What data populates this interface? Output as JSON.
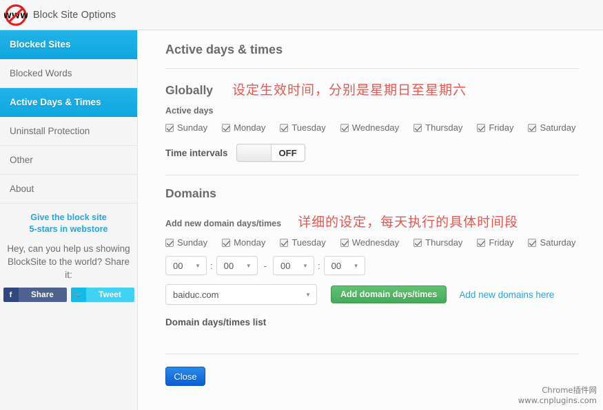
{
  "window": {
    "title": "Block Site Options",
    "logo_icon": "www-blocked-icon"
  },
  "sidebar": {
    "items": [
      {
        "label": "Blocked Sites",
        "active": true
      },
      {
        "label": "Blocked Words",
        "active": false
      },
      {
        "label": "Active Days & Times",
        "active": true
      },
      {
        "label": "Uninstall Protection",
        "active": false
      },
      {
        "label": "Other",
        "active": false
      },
      {
        "label": "About",
        "active": false
      }
    ],
    "rate_line1": "Give the block site",
    "rate_line2": "5-stars in webstore",
    "share_prompt": "Hey, can you help us showing BlockSite to the world? Share it:",
    "facebook": {
      "icon": "facebook-icon",
      "glyph": "f",
      "label": "Share"
    },
    "twitter": {
      "icon": "twitter-icon",
      "glyph": "🐦",
      "label": "Tweet"
    }
  },
  "main": {
    "page_title": "Active days & times",
    "globally": {
      "title": "Globally",
      "note_cn": "设定生效时间，分别是星期日至星期六",
      "active_days_label": "Active days",
      "days": [
        {
          "label": "Sunday",
          "checked": true
        },
        {
          "label": "Monday",
          "checked": true
        },
        {
          "label": "Tuesday",
          "checked": true
        },
        {
          "label": "Wednesday",
          "checked": true
        },
        {
          "label": "Thursday",
          "checked": true
        },
        {
          "label": "Friday",
          "checked": true
        },
        {
          "label": "Saturday",
          "checked": true
        }
      ],
      "time_intervals_label": "Time intervals",
      "toggle_state": "OFF"
    },
    "domains": {
      "title": "Domains",
      "add_label": "Add new domain days/times",
      "note_cn": "详细的设定，每天执行的具体时间段",
      "days": [
        {
          "label": "Sunday",
          "checked": true
        },
        {
          "label": "Monday",
          "checked": true
        },
        {
          "label": "Tuesday",
          "checked": true
        },
        {
          "label": "Wednesday",
          "checked": true
        },
        {
          "label": "Thursday",
          "checked": true
        },
        {
          "label": "Friday",
          "checked": true
        },
        {
          "label": "Saturday",
          "checked": true
        }
      ],
      "time_from_hour": "00",
      "time_from_min": "00",
      "time_to_hour": "00",
      "time_to_min": "00",
      "separator_colon": ":",
      "separator_dash": "-",
      "domain_selected": "baiduc.com",
      "add_button": "Add domain days/times",
      "add_new_link": "Add new domains here",
      "list_label": "Domain days/times list"
    },
    "close_button": "Close"
  },
  "watermark": {
    "line1": "Chrome插件网",
    "line2": "www.cnplugins.com"
  },
  "colors": {
    "accent_blue": "#1aaee4",
    "link_blue": "#27a4dd",
    "note_red": "#e8564f",
    "green_button": "#48a95a",
    "close_blue": "#0a5fd4"
  }
}
